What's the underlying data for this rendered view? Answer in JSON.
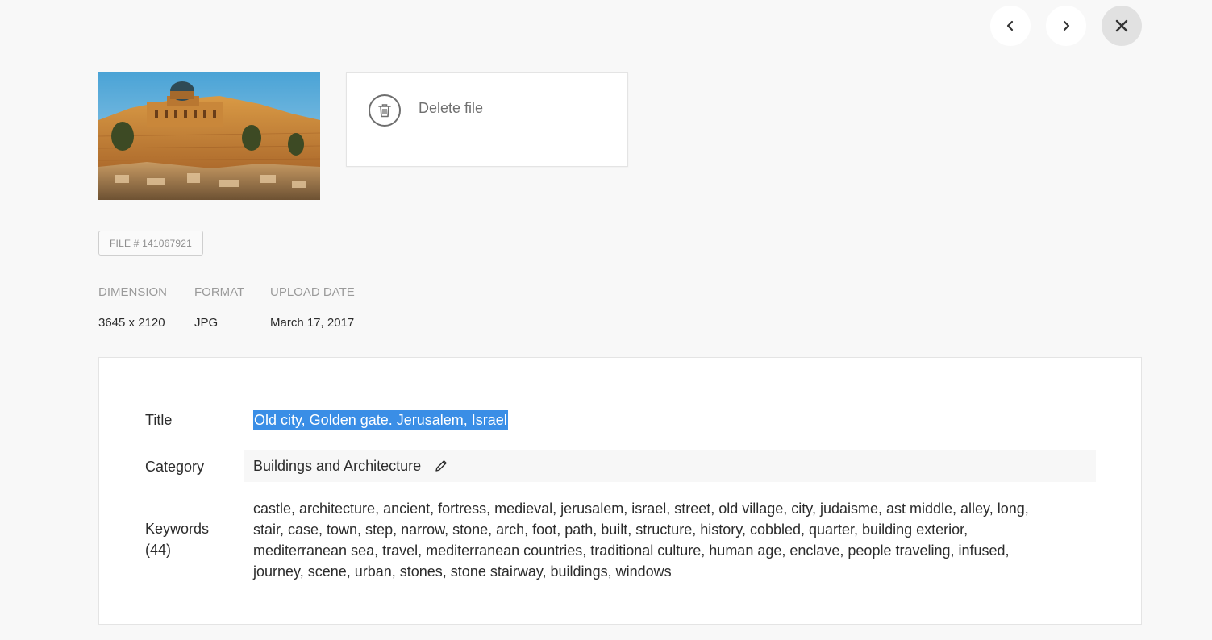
{
  "nav": {
    "prev_icon": "chevron-left-icon",
    "next_icon": "chevron-right-icon",
    "close_icon": "close-icon"
  },
  "delete": {
    "label": "Delete file",
    "icon": "trash-icon"
  },
  "file": {
    "badge": "FILE # 141067921"
  },
  "meta": {
    "dimension_label": "DIMENSION",
    "dimension_value": "3645 x 2120",
    "format_label": "FORMAT",
    "format_value": "JPG",
    "upload_label": "UPLOAD DATE",
    "upload_value": "March 17, 2017"
  },
  "details": {
    "title_label": "Title",
    "title_value": "Old city, Golden gate. Jerusalem, Israel",
    "category_label": "Category",
    "category_value": "Buildings and Architecture",
    "keywords_label": "Keywords",
    "keywords_count": "(44)",
    "keywords_value": "castle, architecture, ancient, fortress, medieval, jerusalem, israel, street, old village, city, judaisme, ast middle, alley, long, stair, case, town, step, narrow, stone, arch, foot, path, built, structure, history, cobbled, quarter, building exterior, mediterranean sea, travel, mediterranean countries, traditional culture, human age, enclave, people traveling, infused, journey, scene, urban, stones, stone stairway, buildings, windows"
  },
  "colors": {
    "background": "#f8f8f8",
    "selection": "#3a8ee6",
    "muted_text": "#9a9a9a",
    "text": "#2c2c2c"
  }
}
